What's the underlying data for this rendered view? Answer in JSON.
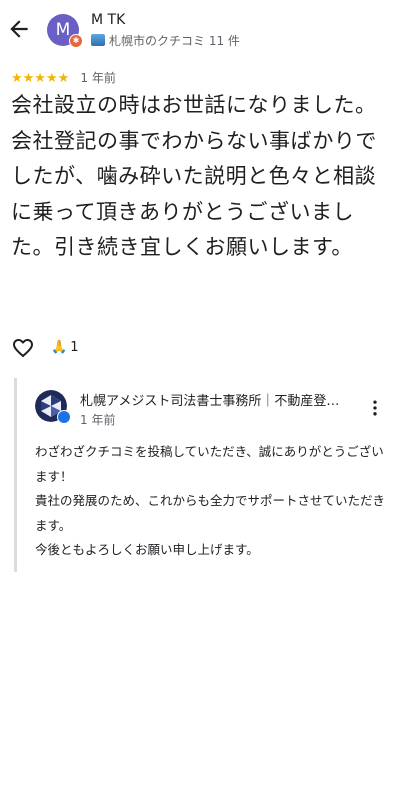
{
  "header": {
    "back_icon": "arrow-left-icon",
    "author": {
      "initial": "M",
      "name": "M TK",
      "meta": "札幌市のクチコミ 11 件",
      "avatar_color": "#6a5fc4",
      "badge_color": "#e8663d"
    }
  },
  "review": {
    "stars": "★★★★★",
    "rating": 5,
    "time": "1 年前",
    "text": "会社設立の時はお世話になりました。会社登記の事でわからない事ばかりでしたが、噛み砕いた説明と色々と相談に乗って頂きありがとうございました。引き続き宜しくお願いします。"
  },
  "actions": {
    "like_icon": "heart-outline-icon",
    "reaction_icon": "folded-hands-icon",
    "reaction_emoji": "🙏",
    "reaction_count": "1"
  },
  "owner_reply": {
    "name": "札幌アメジスト司法書士事務所｜不動産登記・相続登記・会社登記・相続放棄・成年後見",
    "time": "1 年前",
    "more_icon": "more-vert-icon",
    "lines": [
      "わざわざクチコミを投稿していただき、誠にありがとうございます！",
      "貴社の発展のため、これからも全力でサポートさせていただきます。",
      "今後ともよろしくお願い申し上げます。"
    ]
  },
  "colors": {
    "star": "#f4b400",
    "secondary_text": "#5f6368",
    "verified": "#1a73e8"
  }
}
